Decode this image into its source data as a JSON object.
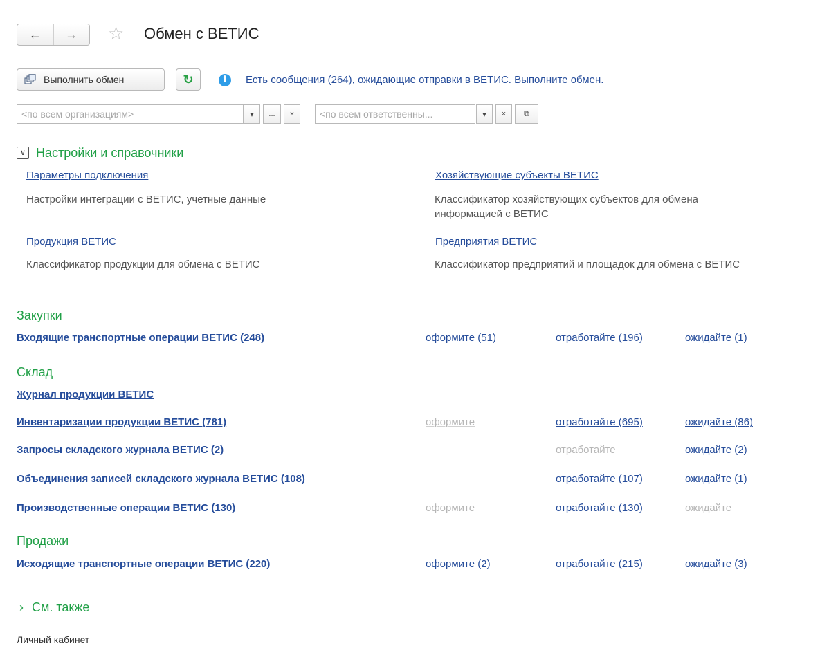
{
  "header": {
    "back_icon": "←",
    "forward_icon": "→",
    "favorite_icon": "☆",
    "title": "Обмен с ВЕТИС"
  },
  "toolbar": {
    "exchange_label": "Выполнить обмен",
    "refresh_icon": "↻",
    "info_icon": "i",
    "message_link": "Есть сообщения (264), ожидающие отправки в ВЕТИС. Выполните обмен."
  },
  "filters": {
    "organization_placeholder": "<по всем организациям>",
    "responsible_placeholder": "<по всем ответственны...",
    "dropdown_icon": "▾",
    "select_icon": "...",
    "clear_icon": "×",
    "open_icon": "⧉"
  },
  "settings": {
    "toggle_icon": "∨",
    "title": "Настройки и справочники",
    "items": [
      {
        "link": "Параметры подключения",
        "desc": "Настройки интеграции с ВЕТИС, учетные данные"
      },
      {
        "link": "Хозяйствующие субъекты ВЕТИС",
        "desc_line1": "Классификатор хозяйствующих субъектов для обмена",
        "desc_line2": "информацией с ВЕТИС"
      },
      {
        "link": "Продукция ВЕТИС",
        "desc": "Классификатор продукции для обмена с ВЕТИС"
      },
      {
        "link": "Предприятия ВЕТИС",
        "desc": "Классификатор предприятий и площадок для обмена с ВЕТИС"
      }
    ]
  },
  "purchases": {
    "title": "Закупки",
    "rows": [
      {
        "name": "Входящие транспортные операции ВЕТИС (248)",
        "make": "оформите (51)",
        "process": "отработайте (196)",
        "wait": "ожидайте (1)"
      }
    ]
  },
  "warehouse": {
    "title": "Склад",
    "journal": "Журнал продукции ВЕТИС",
    "rows": [
      {
        "name": "Инвентаризации продукции ВЕТИС (781)",
        "make": "оформите",
        "process": "отработайте (695)",
        "wait": "ожидайте (86)"
      },
      {
        "name": "Запросы складского журнала ВЕТИС (2)",
        "process": "отработайте",
        "wait": "ожидайте (2)"
      },
      {
        "name": "Объединения записей складского журнала ВЕТИС (108)",
        "process": "отработайте (107)",
        "wait": "ожидайте (1)"
      },
      {
        "name": "Производственные операции ВЕТИС (130)",
        "make": "оформите",
        "process": "отработайте (130)",
        "wait": "ожидайте"
      }
    ]
  },
  "sales": {
    "title": "Продажи",
    "rows": [
      {
        "name": "Исходящие транспортные операции ВЕТИС (220)",
        "make": "оформите (2)",
        "process": "отработайте (215)",
        "wait": "ожидайте (3)"
      }
    ]
  },
  "see_also": {
    "chevron_icon": "›",
    "title": "См. также"
  },
  "footer": {
    "cabinet": "Личный кабинет"
  },
  "colors": {
    "accent_green": "#21a047",
    "link_blue": "#264d9b",
    "info_blue": "#2f9de8",
    "dim_gray": "#b6b6b6"
  }
}
